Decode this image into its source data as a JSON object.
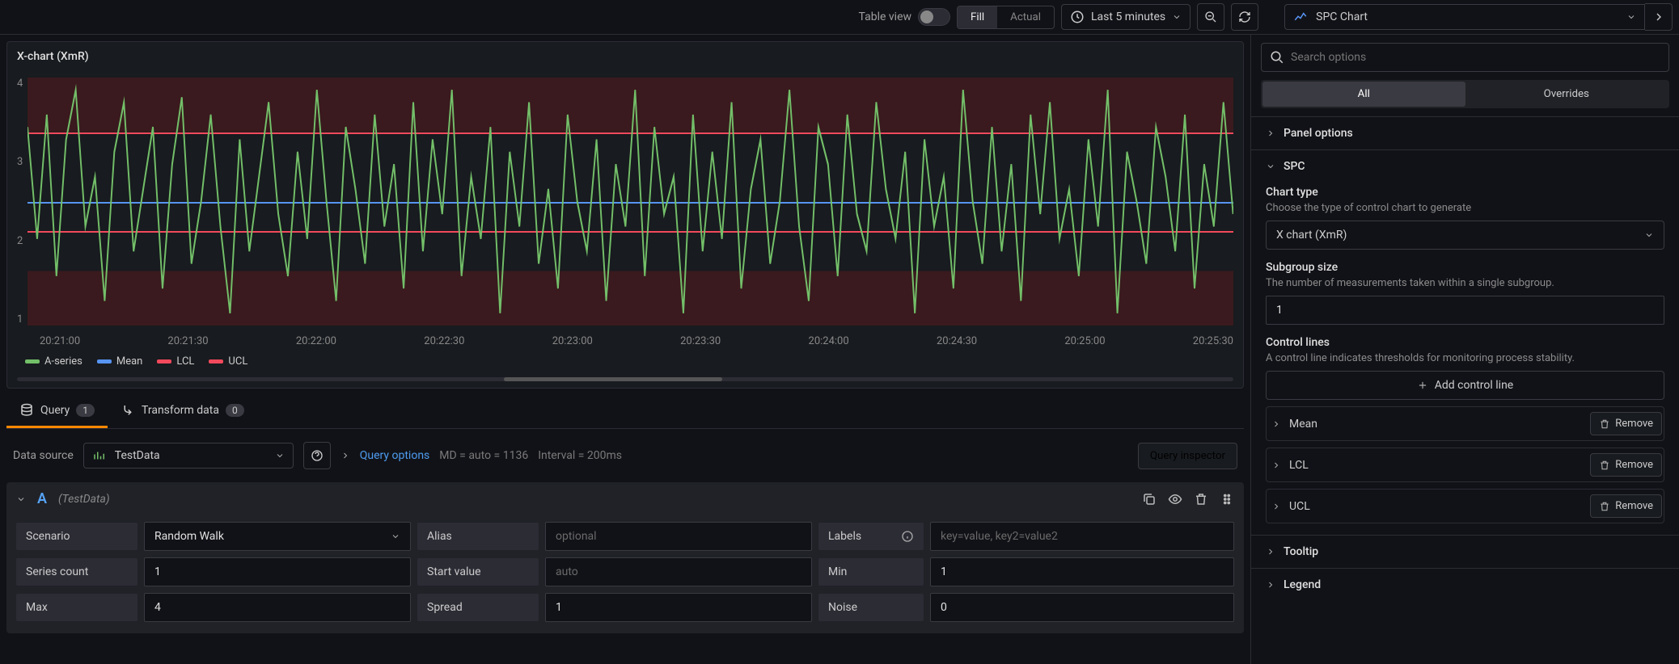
{
  "topbar": {
    "table_view_label": "Table view",
    "fill_label": "Fill",
    "actual_label": "Actual",
    "time_range": "Last 5 minutes",
    "panel_type": "SPC Chart"
  },
  "panel": {
    "title": "X-chart (XmR)",
    "y_ticks": [
      "4",
      "3",
      "2",
      "1"
    ],
    "x_ticks": [
      "20:21:00",
      "20:21:30",
      "20:22:00",
      "20:22:30",
      "20:23:00",
      "20:23:30",
      "20:24:00",
      "20:24:30",
      "20:25:00",
      "20:25:30"
    ],
    "legend": [
      {
        "label": "A-series",
        "color": "#73bf69"
      },
      {
        "label": "Mean",
        "color": "#5794f2"
      },
      {
        "label": "LCL",
        "color": "#f2495c"
      },
      {
        "label": "UCL",
        "color": "#f2495c"
      }
    ]
  },
  "tabs": {
    "query_label": "Query",
    "query_count": "1",
    "transform_label": "Transform data",
    "transform_count": "0"
  },
  "query_bar": {
    "data_source_label": "Data source",
    "data_source_value": "TestData",
    "query_options_label": "Query options",
    "md_text": "MD = auto = 1136",
    "interval_text": "Interval = 200ms",
    "inspector_label": "Query inspector"
  },
  "query_row": {
    "letter": "A",
    "source": "(TestData)",
    "fields": {
      "scenario_label": "Scenario",
      "scenario_value": "Random Walk",
      "alias_label": "Alias",
      "alias_placeholder": "optional",
      "labels_label": "Labels",
      "labels_placeholder": "key=value, key2=value2",
      "series_count_label": "Series count",
      "series_count_value": "1",
      "start_value_label": "Start value",
      "start_value_placeholder": "auto",
      "min_label": "Min",
      "min_value": "1",
      "max_label": "Max",
      "max_value": "4",
      "spread_label": "Spread",
      "spread_value": "1",
      "noise_label": "Noise",
      "noise_value": "0"
    }
  },
  "sidebar": {
    "search_placeholder": "Search options",
    "tab_all": "All",
    "tab_overrides": "Overrides",
    "panel_options_label": "Panel options",
    "spc_label": "SPC",
    "chart_type_label": "Chart type",
    "chart_type_desc": "Choose the type of control chart to generate",
    "chart_type_value": "X chart (XmR)",
    "subgroup_label": "Subgroup size",
    "subgroup_desc": "The number of measurements taken within a single subgroup.",
    "subgroup_value": "1",
    "control_lines_label": "Control lines",
    "control_lines_desc": "A control line indicates thresholds for monitoring process stability.",
    "add_control_line_label": "Add control line",
    "control_lines": [
      "Mean",
      "LCL",
      "UCL"
    ],
    "remove_label": "Remove",
    "tooltip_label": "Tooltip",
    "legend_label": "Legend"
  },
  "chart_data": {
    "type": "line",
    "title": "X-chart (XmR)",
    "xlabel": "",
    "ylabel": "",
    "ylim": [
      0.8,
      4.2
    ],
    "x": [
      "20:21:00",
      "20:21:30",
      "20:22:00",
      "20:22:30",
      "20:23:00",
      "20:23:30",
      "20:24:00",
      "20:24:30",
      "20:25:00",
      "20:25:30"
    ],
    "series": [
      {
        "name": "A-series",
        "color": "#73bf69",
        "values_range": [
          1,
          4
        ],
        "note": "random walk between 1 and 4"
      },
      {
        "name": "Mean",
        "color": "#5794f2",
        "constant": 2.5
      },
      {
        "name": "LCL",
        "color": "#f2495c",
        "constant": 2.1
      },
      {
        "name": "UCL",
        "color": "#f2495c",
        "constant": 3.3
      }
    ]
  }
}
